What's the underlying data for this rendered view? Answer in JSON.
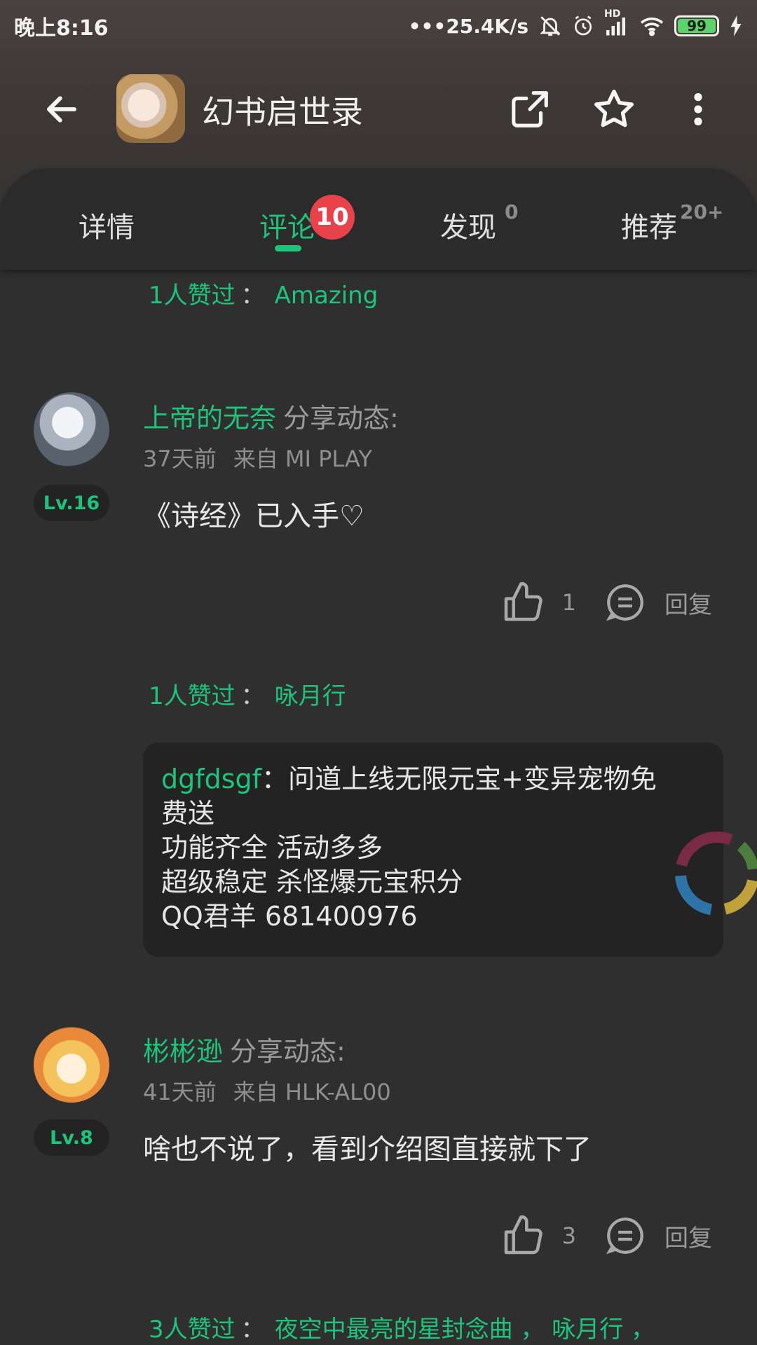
{
  "status_bar": {
    "time": "晚上8:16",
    "network_speed": "25.4K/s",
    "network_type": "HD",
    "battery_level": "99"
  },
  "app_bar": {
    "title": "幻书启世录"
  },
  "tabs": [
    {
      "label": "详情",
      "count": ""
    },
    {
      "label": "评论",
      "badge": "10"
    },
    {
      "label": "发现",
      "count": "0"
    },
    {
      "label": "推荐",
      "count": "20+"
    }
  ],
  "feed": {
    "top_liked": {
      "count_label": "1人赞过",
      "sep": "：",
      "names": "Amazing"
    },
    "posts": [
      {
        "user": "上帝的无奈",
        "action": "分享动态:",
        "time": "37天前",
        "source": "来自 MI PLAY",
        "level": "Lv.16",
        "text": "《诗经》已入手♡",
        "likes": "1",
        "reply_label": "回复",
        "liked_by": {
          "count_label": "1人赞过",
          "sep": "：",
          "names": "咏月行"
        },
        "reply": {
          "author": "dgfdsgf",
          "sep": "：",
          "first_line": "问道上线无限元宝+变异宠物免",
          "lines": [
            "费送",
            "功能齐全 活动多多",
            "超级稳定 杀怪爆元宝积分",
            "QQ君羊 681400976"
          ]
        }
      },
      {
        "user": "彬彬逊",
        "action": "分享动态:",
        "time": "41天前",
        "source": "来自 HLK-AL00",
        "level": "Lv.8",
        "text": "啥也不说了，看到介绍图直接就下了",
        "likes": "3",
        "reply_label": "回复",
        "liked_by": {
          "count_label": "3人赞过",
          "sep": "：",
          "names": "夜空中最亮的星封念曲 ，  咏月行 ，"
        }
      }
    ]
  }
}
